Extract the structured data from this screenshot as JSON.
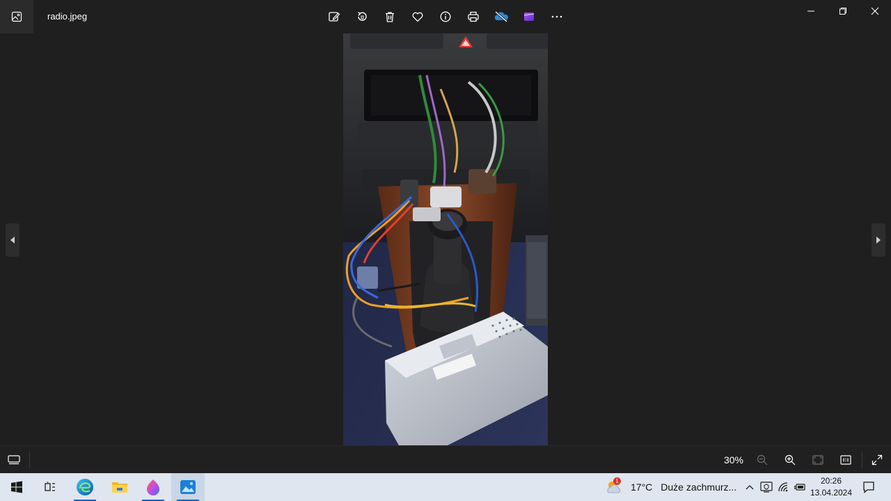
{
  "window": {
    "file_name": "radio.jpeg"
  },
  "toolbar": {
    "items": [
      "edit-image-icon",
      "rotate-icon",
      "delete-icon",
      "favorite-icon",
      "info-icon",
      "print-icon",
      "onedrive-off-icon",
      "clipchamp-icon",
      "more-icon"
    ]
  },
  "viewer": {
    "zoom_label": "30%"
  },
  "taskbar": {
    "weather_temp": "17°C",
    "weather_desc": "Duże zachmurz...",
    "weather_badge": "1",
    "time": "20:26",
    "date": "13.04.2024"
  },
  "colors": {
    "background": "#1f1f1f",
    "taskbar": "#dfe6ef",
    "accent": "#0a64c8"
  }
}
